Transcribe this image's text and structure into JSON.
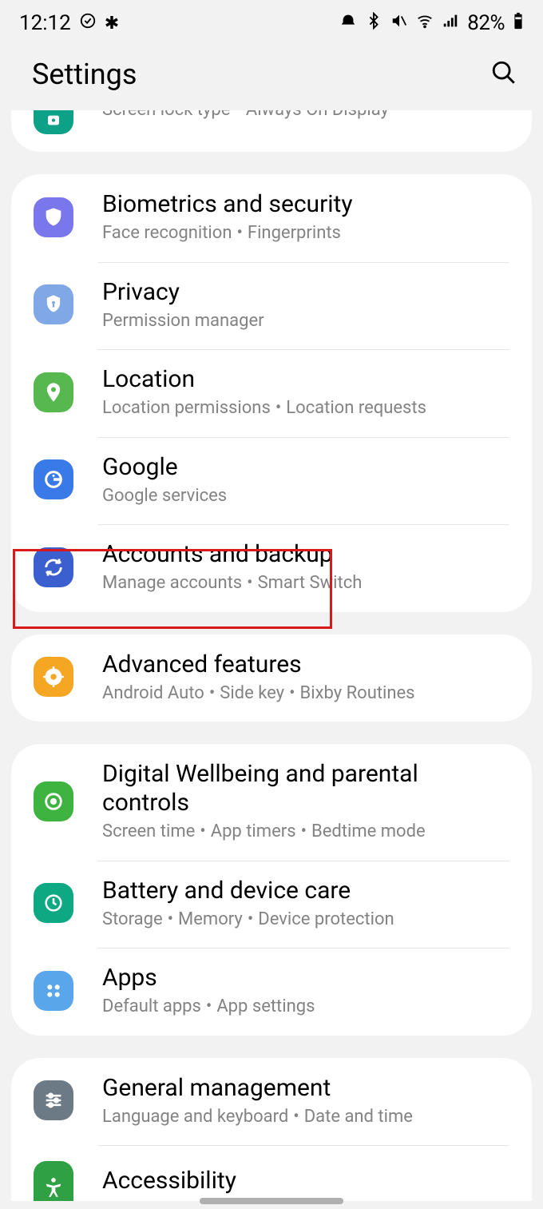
{
  "status": {
    "time": "12:12",
    "battery": "82%"
  },
  "header": {
    "title": "Settings"
  },
  "items": {
    "lock": {
      "sub1": "Screen lock type",
      "sub2": "Always On Display"
    },
    "biometrics": {
      "title": "Biometrics and security",
      "sub1": "Face recognition",
      "sub2": "Fingerprints"
    },
    "privacy": {
      "title": "Privacy",
      "sub1": "Permission manager"
    },
    "location": {
      "title": "Location",
      "sub1": "Location permissions",
      "sub2": "Location requests"
    },
    "google": {
      "title": "Google",
      "sub1": "Google services"
    },
    "accounts": {
      "title": "Accounts and backup",
      "sub1": "Manage accounts",
      "sub2": "Smart Switch"
    },
    "advanced": {
      "title": "Advanced features",
      "sub1": "Android Auto",
      "sub2": "Side key",
      "sub3": "Bixby Routines"
    },
    "wellbeing": {
      "title": "Digital Wellbeing and parental controls",
      "sub1": "Screen time",
      "sub2": "App timers",
      "sub3": "Bedtime mode"
    },
    "battery": {
      "title": "Battery and device care",
      "sub1": "Storage",
      "sub2": "Memory",
      "sub3": "Device protection"
    },
    "apps": {
      "title": "Apps",
      "sub1": "Default apps",
      "sub2": "App settings"
    },
    "general": {
      "title": "General management",
      "sub1": "Language and keyboard",
      "sub2": "Date and time"
    },
    "accessibility": {
      "title": "Accessibility"
    }
  },
  "colors": {
    "lock_screen": "#0da287",
    "biometrics": "#7a76eb",
    "privacy": "#81a8e6",
    "location": "#58b850",
    "google": "#3a79e8",
    "accounts": "#3b5fcf",
    "advanced": "#f5a623",
    "wellbeing": "#3fb33f",
    "battery": "#0ea882",
    "apps": "#5aa6ea",
    "general": "#6c7a85",
    "accessibility": "#2fa043"
  },
  "highlight": {
    "target": "accounts"
  }
}
